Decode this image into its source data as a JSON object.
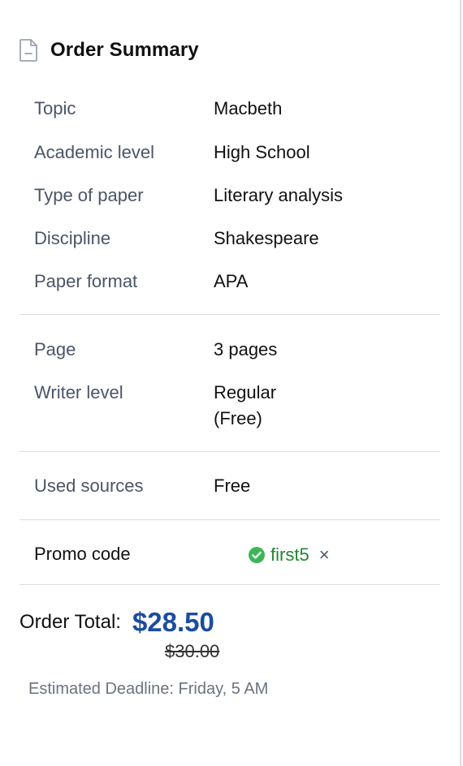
{
  "header": {
    "icon": "document-icon",
    "title": "Order Summary"
  },
  "details": [
    {
      "label": "Topic",
      "value": "Macbeth"
    },
    {
      "label": "Academic level",
      "value": "High School"
    },
    {
      "label": "Type of paper",
      "value": "Literary analysis"
    },
    {
      "label": "Discipline",
      "value": "Shakespeare"
    },
    {
      "label": "Paper format",
      "value": "APA"
    }
  ],
  "options": {
    "page": {
      "label": "Page",
      "value": "3 pages"
    },
    "writer": {
      "label": "Writer level",
      "value_line1": "Regular",
      "value_line2": "(Free)"
    }
  },
  "sources": {
    "label": "Used sources",
    "value": "Free"
  },
  "promo": {
    "label": "Promo code",
    "code": "first5",
    "status_icon": "check-circle-icon",
    "remove_icon": "close-icon",
    "remove_glyph": "×"
  },
  "total": {
    "label": "Order Total:",
    "price": "$28.50",
    "original_price": "$30.00"
  },
  "deadline": "Estimated Deadline: Friday, 5 AM",
  "colors": {
    "accent": "#1b4d9e",
    "promo_green": "#20882f",
    "label_gray": "#4b5567"
  }
}
